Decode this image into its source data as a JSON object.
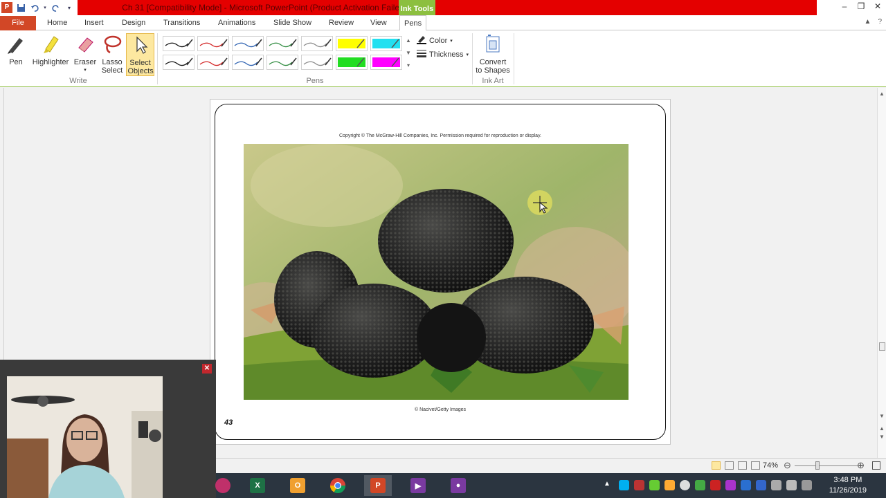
{
  "window": {
    "title": "Ch 31 [Compatibility Mode]  -  Microsoft PowerPoint (Product Activation Failed)",
    "contextual_tab": "Ink Tools"
  },
  "tabs": [
    "File",
    "Home",
    "Insert",
    "Design",
    "Transitions",
    "Animations",
    "Slide Show",
    "Review",
    "View",
    "Pens"
  ],
  "active_tab": "Pens",
  "ribbon": {
    "write_group": {
      "label": "Write",
      "buttons": [
        "Pen",
        "Highlighter",
        "Eraser",
        "Lasso Select",
        "Select Objects"
      ]
    },
    "pens_group": {
      "label": "Pens",
      "pen_colors": [
        "#111111",
        "#d22222",
        "#2a5fb0",
        "#2e8b3e",
        "#888888",
        "#ffff00",
        "#22e0f0",
        "#111111",
        "#d22222",
        "#2a5fb0",
        "#2e8b3e",
        "#888888",
        "#22dd22",
        "#ff00ff"
      ]
    },
    "color_label": "Color",
    "thickness_label": "Thickness",
    "ink_art_group": {
      "label": "Ink Art",
      "convert_label_1": "Convert",
      "convert_label_2": "to Shapes"
    }
  },
  "slide": {
    "copyright": "Copyright © The McGraw-Hill Companies, Inc. Permission required for reproduction or display.",
    "photo_credit": "© Nacivet/Getty Images",
    "slide_number": "43"
  },
  "status": {
    "zoom": "74%"
  },
  "taskbar": {
    "time": "3:48 PM",
    "date": "11/26/2019"
  },
  "colors": {
    "title_red": "#e40000",
    "ink_tools_green": "#8cbf3f",
    "file_tab": "#d24726"
  }
}
